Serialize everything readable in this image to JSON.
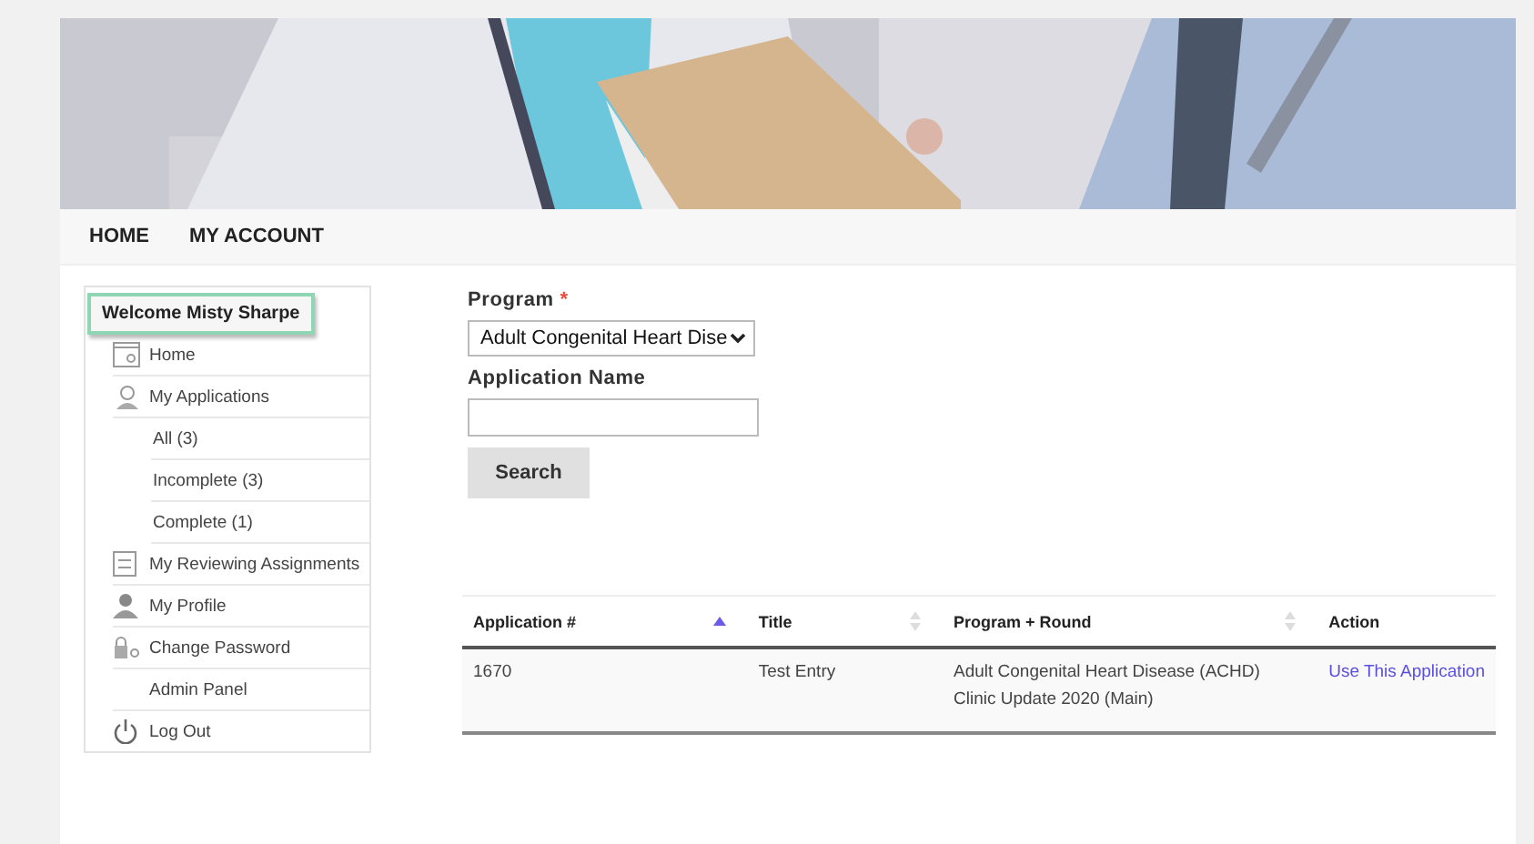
{
  "nav": [
    {
      "label": "HOME"
    },
    {
      "label": "MY ACCOUNT"
    }
  ],
  "sidebar": {
    "welcome": "Welcome Misty Sharpe",
    "items": [
      {
        "label": "Home",
        "kind": "calendar"
      },
      {
        "label": "My Applications",
        "kind": "search",
        "children": [
          {
            "label": "All (3)"
          },
          {
            "label": "Incomplete (3)"
          },
          {
            "label": "Complete (1)"
          }
        ]
      },
      {
        "label": "My Reviewing Assignments",
        "kind": "form"
      },
      {
        "label": "My Profile",
        "kind": "person"
      },
      {
        "label": "Change Password",
        "kind": "lock"
      },
      {
        "label": "Admin Panel",
        "kind": "plain"
      },
      {
        "label": "Log Out",
        "kind": "power"
      }
    ]
  },
  "form": {
    "program_label": "Program",
    "required_mark": "*",
    "program_value": "Adult Congenital Heart Dise",
    "name_label": "Application Name",
    "search_button": "Search"
  },
  "table": {
    "columns": [
      {
        "label": "Application #",
        "kind": "sorted"
      },
      {
        "label": "Title",
        "kind": "sortable"
      },
      {
        "label": "Program + Round",
        "kind": "sortable"
      },
      {
        "label": "Action",
        "kind": "plain"
      }
    ],
    "rows": [
      {
        "id": "1670",
        "title": "Test Entry",
        "program": "Adult Congenital Heart Disease (ACHD) Clinic Update 2020 (Main)",
        "action": "Use This Application"
      }
    ]
  }
}
